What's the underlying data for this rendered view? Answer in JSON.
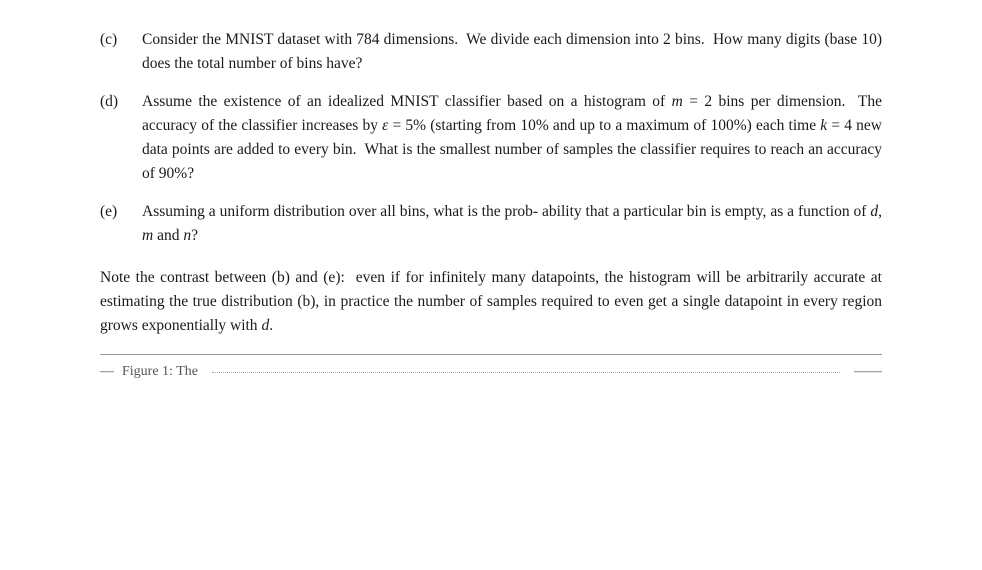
{
  "content": {
    "items": [
      {
        "id": "c",
        "label": "(c)",
        "text": "Consider the MNIST dataset with 784 dimensions.  We divide each dimension into 2 bins.  How many digits (base 10) does the total number of bins have?"
      },
      {
        "id": "d",
        "label": "(d)",
        "text": "Assume the existence of an idealized MNIST classifier based on a histogram of m = 2 bins per dimension.  The accuracy of the classifier increases by ε = 5% (starting from 10% and up to a maximum of 100%) each time k = 4 new data points are added to every bin.  What is the smallest number of samples the classifier requires to reach an accuracy of 90%?"
      },
      {
        "id": "e",
        "label": "(e)",
        "text": "Assuming a uniform distribution over all bins, what is the prob- ability that a particular bin is empty, as a function of d, m and n?"
      }
    ],
    "note": {
      "text": "Note the contrast between (b) and (e):  even if for infinitely many datapoints, the histogram will be arbitrarily accurate at estimating the true distribution (b), in practice the number of samples required to even get a single datapoint in every region grows exponentially with d."
    },
    "bottom_placeholder": "— Figure 1: The ——————————————————"
  }
}
